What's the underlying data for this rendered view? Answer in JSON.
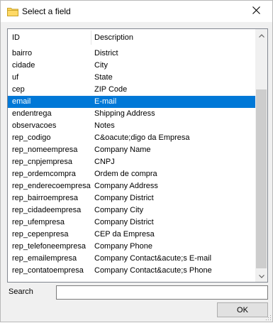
{
  "window": {
    "title": "Select a field",
    "icon": "folder-icon"
  },
  "list": {
    "columns": [
      "ID",
      "Description"
    ],
    "rows": [
      {
        "id": "bairro",
        "description": "District"
      },
      {
        "id": "cidade",
        "description": "City"
      },
      {
        "id": "uf",
        "description": "State"
      },
      {
        "id": "cep",
        "description": "ZIP Code"
      },
      {
        "id": "email",
        "description": "E-mail",
        "selected": true
      },
      {
        "id": "endentrega",
        "description": "Shipping Address"
      },
      {
        "id": "observacoes",
        "description": "Notes"
      },
      {
        "id": "rep_codigo",
        "description": "C&oacute;digo da Empresa"
      },
      {
        "id": "rep_nomeempresa",
        "description": "Company Name"
      },
      {
        "id": "rep_cnpjempresa",
        "description": "CNPJ"
      },
      {
        "id": "rep_ordemcompra",
        "description": "Ordem de compra"
      },
      {
        "id": "rep_enderecoempresa",
        "description": "Company Address"
      },
      {
        "id": "rep_bairroempresa",
        "description": "Company District"
      },
      {
        "id": "rep_cidadeempresa",
        "description": "Company City"
      },
      {
        "id": "rep_ufempresa",
        "description": "Company District"
      },
      {
        "id": "rep_cepenpresa",
        "description": "CEP da Empresa"
      },
      {
        "id": "rep_telefoneempresa",
        "description": "Company Phone"
      },
      {
        "id": "rep_emailempresa",
        "description": "Company Contact&acute;s E-mail"
      },
      {
        "id": "rep_contatoempresa",
        "description": "Company Contact&acute;s Phone"
      }
    ]
  },
  "search": {
    "label": "Search",
    "value": ""
  },
  "buttons": {
    "ok": "OK"
  },
  "colors": {
    "selection": "#0078d7",
    "window_bg": "#f0f0f0"
  }
}
